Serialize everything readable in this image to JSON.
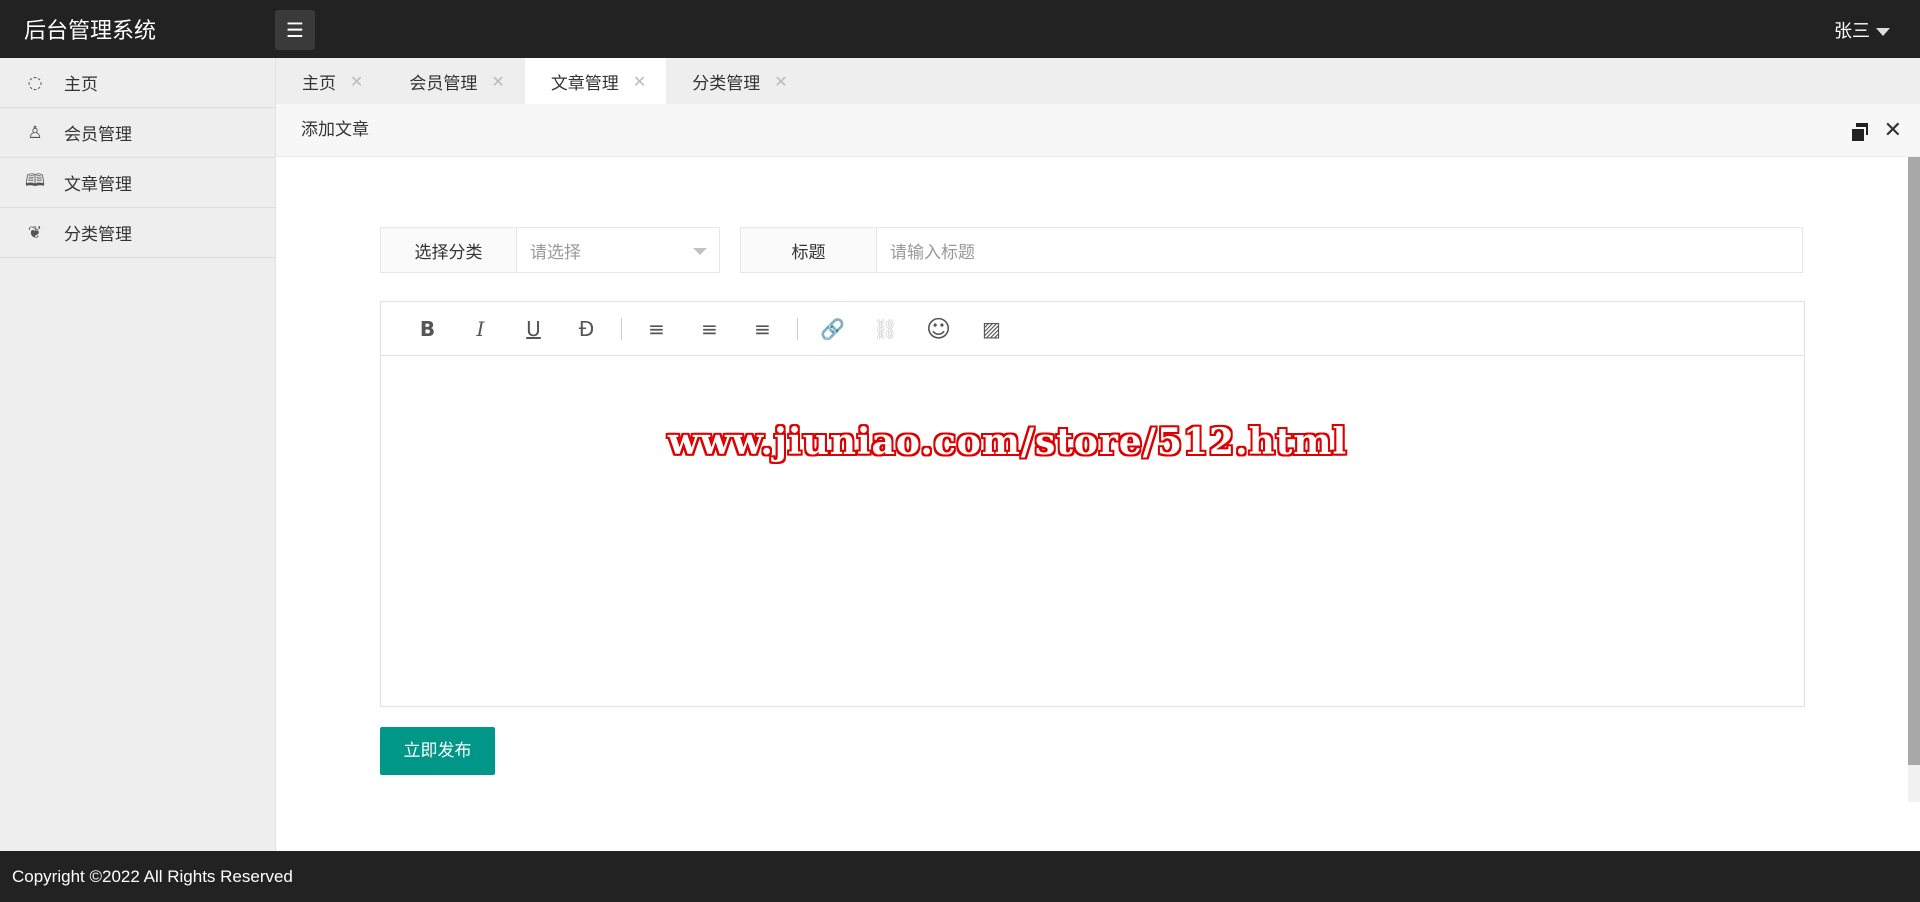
{
  "header": {
    "title": "后台管理系统",
    "menu_icon": "☰",
    "user": "张三"
  },
  "sidebar": {
    "items": [
      {
        "label": "主页",
        "icon": "◌"
      },
      {
        "label": "会员管理",
        "icon": "♙"
      },
      {
        "label": "文章管理",
        "icon": "🕮"
      },
      {
        "label": "分类管理",
        "icon": "❦"
      }
    ]
  },
  "tabs": [
    {
      "label": "主页"
    },
    {
      "label": "会员管理"
    },
    {
      "label": "文章管理",
      "active": true
    },
    {
      "label": "分类管理"
    }
  ],
  "panel": {
    "title": "添加文章"
  },
  "form": {
    "category_label": "选择分类",
    "category_placeholder": "请选择",
    "title_label": "标题",
    "title_placeholder": "请输入标题"
  },
  "toolbar": [
    "B",
    "I",
    "U",
    "Đ",
    "≡",
    "≡",
    "≡",
    "🔗",
    "⛓",
    "☺",
    "▨"
  ],
  "editor": {
    "watermark": "www.jiuniao.com/store/512.html"
  },
  "publish_label": "立即发布",
  "footer": "Copyright ©2022 All Rights Reserved"
}
